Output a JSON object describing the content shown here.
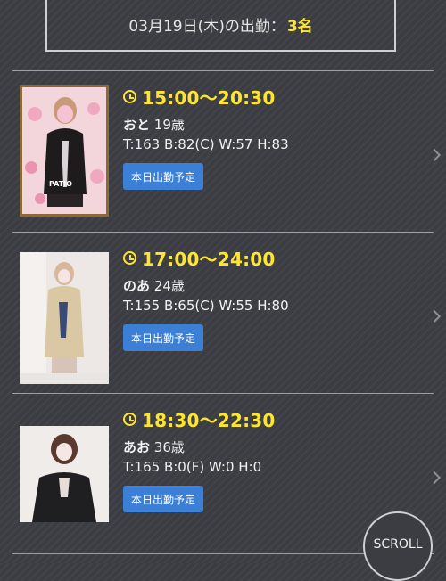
{
  "header": {
    "date_text": "03月19日(木)の出勤：",
    "count_text": "3名"
  },
  "cast": [
    {
      "time": "15:00〜20:30",
      "name": "おと",
      "age": "19歳",
      "stats": "T:163 B:82(C) W:57 H:83",
      "badge": "本日出勤予定",
      "photo_caption": "PATIO"
    },
    {
      "time": "17:00〜24:00",
      "name": "のあ",
      "age": "24歳",
      "stats": "T:155 B:65(C) W:55 H:80",
      "badge": "本日出勤予定"
    },
    {
      "time": "18:30〜22:30",
      "name": "あお",
      "age": "36歳",
      "stats": "T:165 B:0(F) W:0 H:0",
      "badge": "本日出勤予定"
    }
  ],
  "scroll_label": "SCROLL",
  "colors": {
    "accent_yellow": "#ffe62e",
    "badge_blue": "#3b7fd6",
    "background": "#3b3d42"
  }
}
